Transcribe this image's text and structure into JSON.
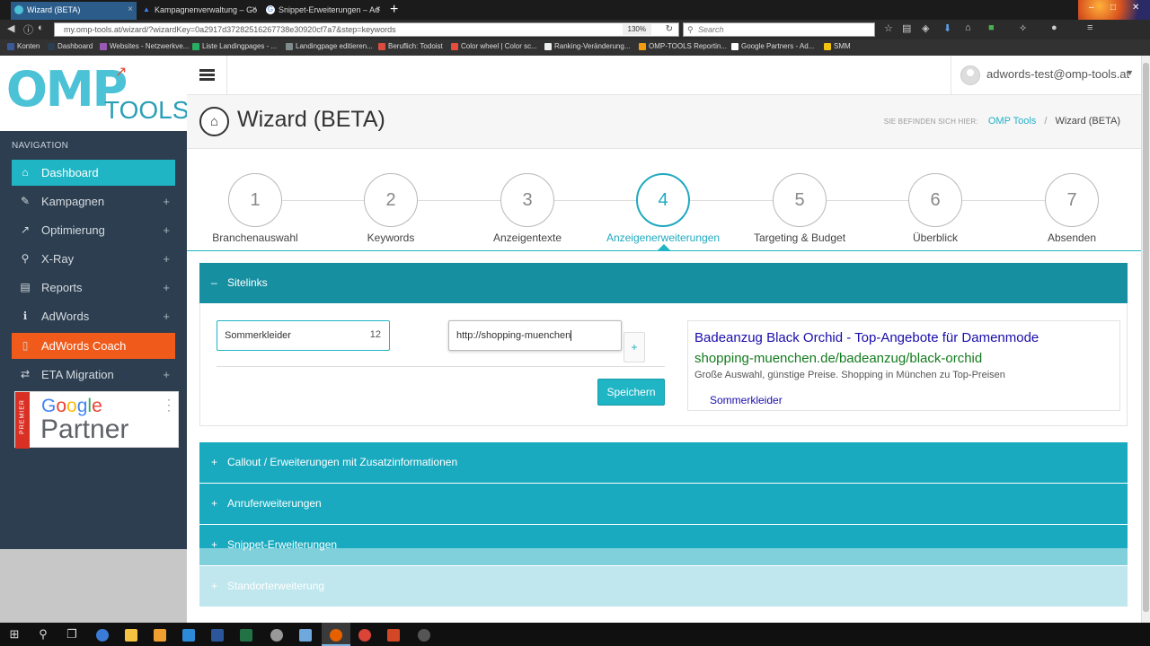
{
  "browser": {
    "tabs": [
      {
        "title": "Wizard (BETA)",
        "active": true
      },
      {
        "title": "Kampagnenverwaltung – Go",
        "active": false
      },
      {
        "title": "Snippet-Erweiterungen – Ad",
        "active": false
      }
    ],
    "url": "my.omp-tools.at/wizard/?wizardKey=0a2917d37282516267738e30920cf7a7&step=keywords",
    "zoom": "130%",
    "search_placeholder": "Search",
    "bookmarks": [
      {
        "label": "Konten",
        "color": "#3b5998"
      },
      {
        "label": "Dashboard",
        "color": "#2c3e50"
      },
      {
        "label": "Websites - Netzwerkve...",
        "color": "#9b59b6"
      },
      {
        "label": "Liste Landingpages - ...",
        "color": "#27ae60"
      },
      {
        "label": "Landingpage editieren...",
        "color": "#7f8c8d"
      },
      {
        "label": "Beruflich: Todoist",
        "color": "#db4c3f"
      },
      {
        "label": "Color wheel | Color sc...",
        "color": "#e74c3c"
      },
      {
        "label": "Ranking-Veränderung...",
        "color": "#ecf0f1"
      },
      {
        "label": "OMP-TOOLS Reportin...",
        "color": "#f39c12"
      },
      {
        "label": "Google Partners - Ad...",
        "color": "#ffffff"
      },
      {
        "label": "SMM",
        "color": "#f1c40f"
      }
    ]
  },
  "sidebar": {
    "heading": "NAVIGATION",
    "logo_omp": "OMP",
    "logo_tools": "TOOLS",
    "items": [
      {
        "label": "Dashboard",
        "icon": "⌂",
        "plus": ""
      },
      {
        "label": "Kampagnen",
        "icon": "✎",
        "plus": "+"
      },
      {
        "label": "Optimierung",
        "icon": "↗",
        "plus": "+"
      },
      {
        "label": "X-Ray",
        "icon": "⚲",
        "plus": "+"
      },
      {
        "label": "Reports",
        "icon": "▤",
        "plus": "+"
      },
      {
        "label": "AdWords",
        "icon": "ℹ",
        "plus": "+"
      },
      {
        "label": "AdWords Coach",
        "icon": "▯",
        "plus": ""
      },
      {
        "label": "ETA Migration",
        "icon": "⇄",
        "plus": "+"
      }
    ],
    "partner_badge": {
      "premier": "PREMIER",
      "google": "Google",
      "partner": "Partner"
    }
  },
  "header": {
    "user_email": "adwords-test@omp-tools.at",
    "page_title": "Wizard (BETA)",
    "breadcrumb_label": "SIE BEFINDEN SICH HIER:",
    "breadcrumb_link": "OMP Tools",
    "breadcrumb_sep": "/",
    "breadcrumb_current": "Wizard (BETA)"
  },
  "wizard": {
    "active_step": 4,
    "steps": [
      {
        "number": "1",
        "label": "Branchenauswahl"
      },
      {
        "number": "2",
        "label": "Keywords"
      },
      {
        "number": "3",
        "label": "Anzeigentexte"
      },
      {
        "number": "4",
        "label": "Anzeigenerweiterungen"
      },
      {
        "number": "5",
        "label": "Targeting & Budget"
      },
      {
        "number": "6",
        "label": "Überblick"
      },
      {
        "number": "7",
        "label": "Absenden"
      }
    ]
  },
  "sitelinks": {
    "section_title": "Sitelinks",
    "toggle": "–",
    "text_value": "Sommerkleider",
    "char_counter": "12",
    "url_value": "http://shopping-muenchen",
    "plus_label": "+",
    "save_label": "Speichern",
    "preview": {
      "headline": "Badeanzug Black Orchid - Top-Angebote für Damenmode",
      "display_url": "shopping-muenchen.de/badeanzug/black-orchid",
      "description": "Große Auswahl, günstige Preise. Shopping in München zu Top-Preisen",
      "sitelink": "Sommerkleider"
    }
  },
  "sections": [
    {
      "title": "Callout / Erweiterungen mit Zusatzinformationen",
      "toggle": "+"
    },
    {
      "title": "Anruferweiterungen",
      "toggle": "+"
    },
    {
      "title": "Snippet-Erweiterungen",
      "toggle": "+"
    },
    {
      "title": "Standorterweiterung",
      "toggle": "+"
    }
  ],
  "colors": {
    "accent": "#1fb5c5",
    "sidebar_bg": "#2c3e50",
    "coach_orange": "#f05a1a",
    "ad_headline": "#1a0dab",
    "ad_url": "#137b1e"
  }
}
